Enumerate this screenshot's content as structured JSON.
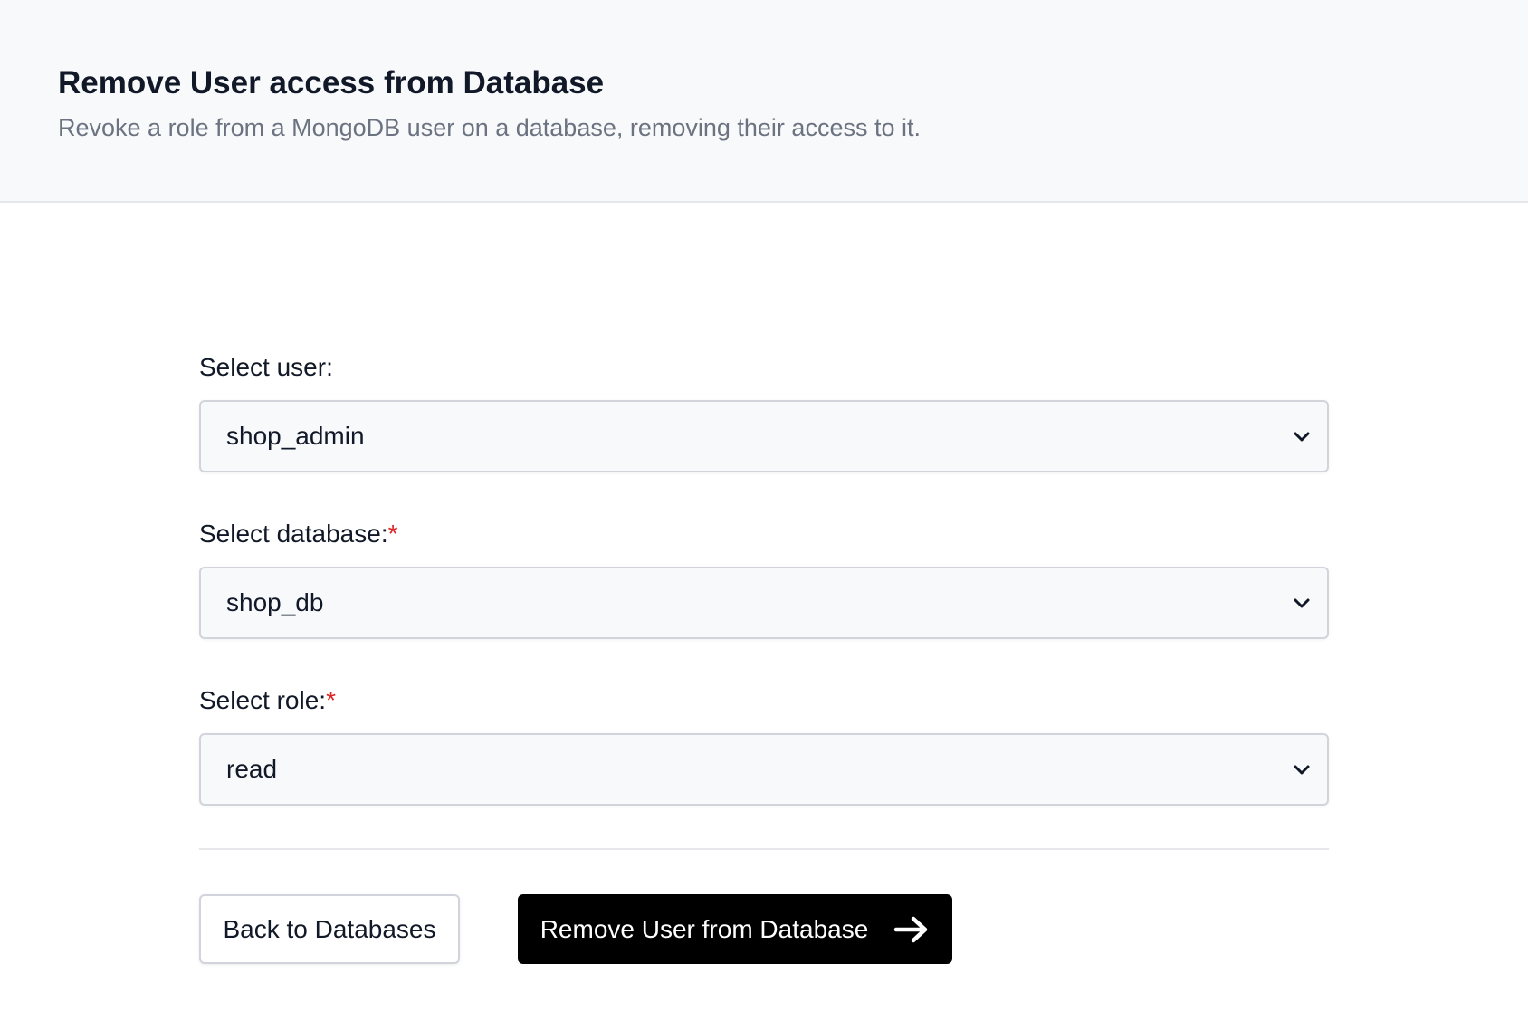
{
  "header": {
    "title": "Remove User access from Database",
    "subtitle": "Revoke a role from a MongoDB user on a database, removing their access to it."
  },
  "form": {
    "user": {
      "label": "Select user:",
      "required": false,
      "value": "shop_admin"
    },
    "database": {
      "label": "Select database:",
      "required": true,
      "value": "shop_db"
    },
    "role": {
      "label": "Select role:",
      "required": true,
      "value": "read"
    },
    "required_marker": "*"
  },
  "actions": {
    "back_label": "Back to Databases",
    "submit_label": "Remove User from Database",
    "submit_icon": "arrow-right-icon"
  },
  "colors": {
    "primary_button": "#000000",
    "required_marker": "#dc2626",
    "header_bg": "#f8f9fb"
  }
}
